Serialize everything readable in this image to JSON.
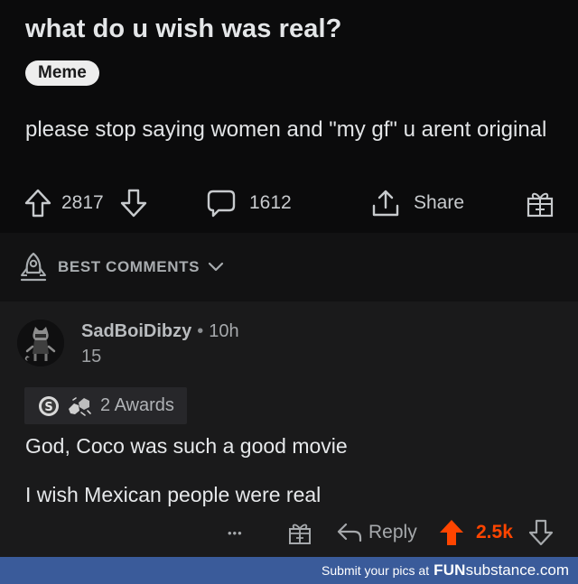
{
  "post": {
    "title": "what do u wish was real?",
    "flair": "Meme",
    "body": "please stop saying women and \"my gf\" u arent original",
    "upvotes": "2817",
    "comments": "1612",
    "share_label": "Share"
  },
  "sort": {
    "label": "BEST COMMENTS"
  },
  "comment": {
    "author": "SadBoiDibzy",
    "separator": "•",
    "age": "10h",
    "karma": "15",
    "awards_label": "2 Awards",
    "line1": "God, Coco was such a good movie",
    "line2": "I wish Mexican people were real",
    "more": "•••",
    "reply_label": "Reply",
    "score": "2.5k"
  },
  "watermark": {
    "prefix": "Submit your pics at",
    "brand": "FUN",
    "brand2": "substance",
    "suffix": ".com"
  },
  "colors": {
    "background": "#0b0b0c",
    "comment_bg": "#1a1a1b",
    "upvote_orange": "#ff4500",
    "watermark_bg": "#3a5b9a"
  },
  "icons": [
    "upvote-icon",
    "downvote-icon",
    "comment-icon",
    "share-icon",
    "gift-icon",
    "rocket-icon",
    "chevron-down-icon",
    "silver-award-icon",
    "fist-bump-icon",
    "reply-icon",
    "more-icon"
  ]
}
